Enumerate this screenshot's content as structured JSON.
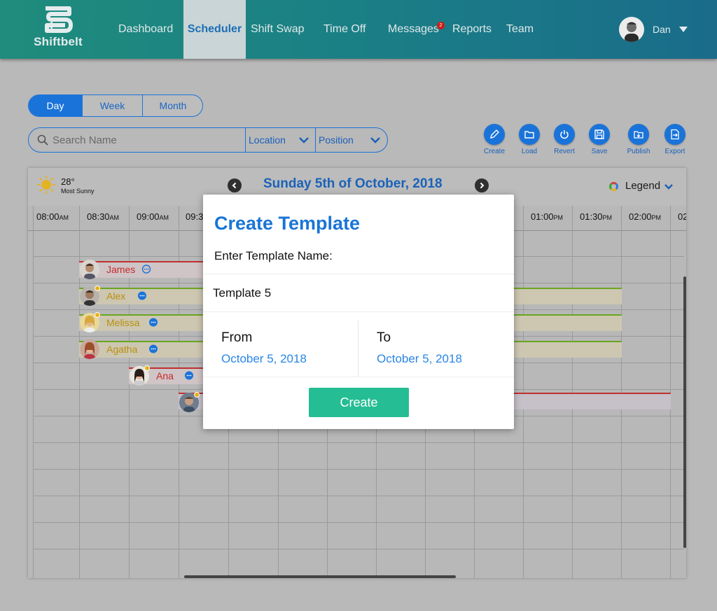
{
  "brand": {
    "name": "Shiftbelt"
  },
  "nav": {
    "items": [
      {
        "label": "Dashboard"
      },
      {
        "label": "Scheduler",
        "active": true
      },
      {
        "label": "Shift Swap"
      },
      {
        "label": "Time Off"
      },
      {
        "label": "Messages",
        "badge": "2"
      },
      {
        "label": "Reports"
      },
      {
        "label": "Team"
      }
    ]
  },
  "user": {
    "name": "Dan"
  },
  "view_toggle": {
    "items": [
      "Day",
      "Week",
      "Month"
    ],
    "selected": "Day"
  },
  "search": {
    "placeholder": "Search Name",
    "location_label": "Location",
    "position_label": "Position"
  },
  "toolbar": {
    "create": "Create",
    "load": "Load",
    "revert": "Revert",
    "save": "Save",
    "publish": "Publish",
    "export": "Export"
  },
  "weather": {
    "temp": "28°",
    "condition": "Most Sunny"
  },
  "schedule": {
    "date_title": "Sunday 5th of October, 2018",
    "legend_label": "Legend",
    "times": [
      {
        "t": "08:00",
        "p": "AM"
      },
      {
        "t": "08:30",
        "p": "AM"
      },
      {
        "t": "09:00",
        "p": "AM"
      },
      {
        "t": "09:3",
        "p": ""
      },
      {
        "t": "01:00",
        "p": "PM"
      },
      {
        "t": "01:30",
        "p": "PM"
      },
      {
        "t": "02:00",
        "p": "PM"
      },
      {
        "t": "02",
        "p": ""
      }
    ],
    "employees": [
      {
        "name": "James"
      },
      {
        "name": "Alex"
      },
      {
        "name": "Melissa"
      },
      {
        "name": "Agatha"
      },
      {
        "name": "Ana"
      }
    ]
  },
  "modal": {
    "title": "Create Template",
    "prompt": "Enter Template Name:",
    "template_name": "Template 5",
    "from_label": "From",
    "from_value": "October 5, 2018",
    "to_label": "To",
    "to_value": "October 5, 2018",
    "create_label": "Create"
  },
  "colors": {
    "accent": "#1a73d9",
    "header_start": "#1f8c7c",
    "header_end": "#1a6c8a",
    "create_green": "#25bd94"
  }
}
